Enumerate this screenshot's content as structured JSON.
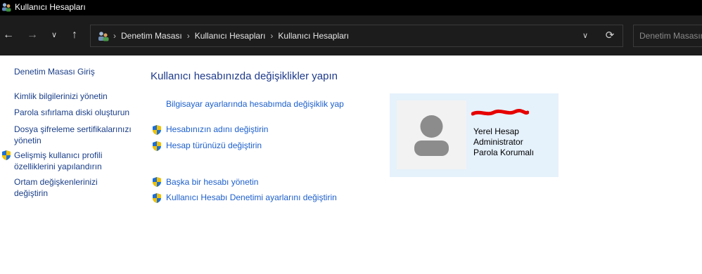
{
  "window": {
    "title": "Kullanıcı Hesapları"
  },
  "nav": {
    "breadcrumbs": [
      "Denetim Masası",
      "Kullanıcı Hesapları",
      "Kullanıcı Hesapları"
    ],
    "search_placeholder": "Denetim Masasın"
  },
  "sidebar": {
    "home": "Denetim Masası Giriş",
    "items": [
      "Kimlik bilgilerinizi yönetin",
      "Parola sıfırlama diski oluşturun",
      "Dosya şifreleme sertifikalarınızı yönetin",
      "Gelişmiş kullanıcı profili özelliklerini yapılandırın",
      "Ortam değişkenlerinizi değiştirin"
    ]
  },
  "main": {
    "title": "Kullanıcı hesabınızda değişiklikler yapın",
    "pc_settings_link": "Bilgisayar ayarlarında hesabımda değişiklik yap",
    "actions": [
      "Hesabınızın adını değiştirin",
      "Hesap türünüzü değiştirin",
      "Başka bir hesabı yönetin",
      "Kullanıcı Hesabı Denetimi ayarlarını değiştirin"
    ]
  },
  "account": {
    "type": "Yerel Hesap",
    "role": "Administrator",
    "protection": "Parola Korumalı"
  },
  "colors": {
    "link": "#1c5fcc",
    "sidebar_link": "#1a3e88",
    "card_bg": "#e5f1fb",
    "redaction": "#e60000"
  },
  "icons": [
    "users-icon",
    "back-arrow-icon",
    "forward-arrow-icon",
    "recent-dropdown-icon",
    "up-arrow-icon",
    "refresh-icon",
    "uac-shield-icon"
  ]
}
